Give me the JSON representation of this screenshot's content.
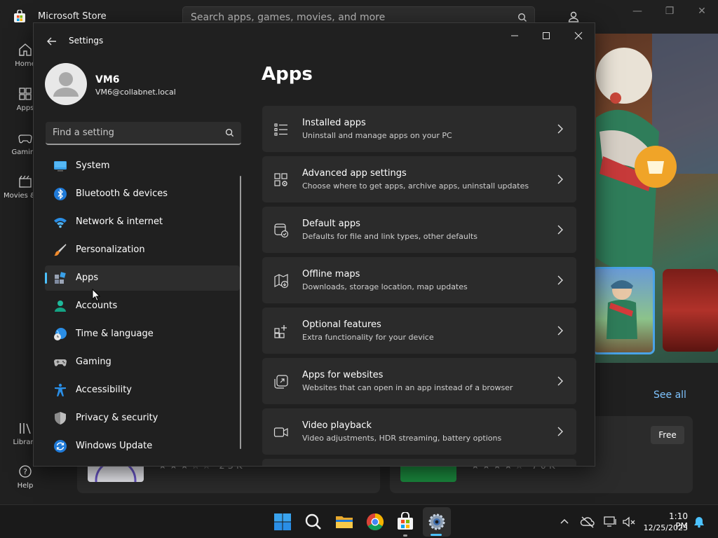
{
  "store": {
    "title": "Microsoft Store",
    "search_placeholder": "Search apps, games, movies, and more",
    "nav": [
      {
        "label": "Home",
        "icon": "home-icon"
      },
      {
        "label": "Apps",
        "icon": "apps-icon"
      },
      {
        "label": "Gaming",
        "icon": "gaming-icon"
      },
      {
        "label": "Movies & TV",
        "icon": "movies-icon"
      },
      {
        "label": "Library",
        "icon": "library-icon"
      },
      {
        "label": "Help",
        "icon": "help-icon"
      }
    ],
    "see_all": "See all",
    "free_badge": "Free",
    "card1_reviews": "23K",
    "card2_reviews": "70K"
  },
  "settings": {
    "window_title": "Settings",
    "user": {
      "name": "VM6",
      "email": "VM6@collabnet.local"
    },
    "search_placeholder": "Find a setting",
    "nav": [
      {
        "label": "System",
        "icon": "system-icon",
        "active": false
      },
      {
        "label": "Bluetooth & devices",
        "icon": "bluetooth-icon",
        "active": false
      },
      {
        "label": "Network & internet",
        "icon": "wifi-icon",
        "active": false
      },
      {
        "label": "Personalization",
        "icon": "brush-icon",
        "active": false
      },
      {
        "label": "Apps",
        "icon": "apps-icon",
        "active": true
      },
      {
        "label": "Accounts",
        "icon": "accounts-icon",
        "active": false
      },
      {
        "label": "Time & language",
        "icon": "globe-clock-icon",
        "active": false
      },
      {
        "label": "Gaming",
        "icon": "controller-icon",
        "active": false
      },
      {
        "label": "Accessibility",
        "icon": "accessibility-icon",
        "active": false
      },
      {
        "label": "Privacy & security",
        "icon": "shield-icon",
        "active": false
      },
      {
        "label": "Windows Update",
        "icon": "update-icon",
        "active": false
      }
    ],
    "page_title": "Apps",
    "cards": [
      {
        "title": "Installed apps",
        "subtitle": "Uninstall and manage apps on your PC",
        "icon": "list-icon"
      },
      {
        "title": "Advanced app settings",
        "subtitle": "Choose where to get apps, archive apps, uninstall updates",
        "icon": "app-settings-icon"
      },
      {
        "title": "Default apps",
        "subtitle": "Defaults for file and link types, other defaults",
        "icon": "default-apps-icon"
      },
      {
        "title": "Offline maps",
        "subtitle": "Downloads, storage location, map updates",
        "icon": "map-icon"
      },
      {
        "title": "Optional features",
        "subtitle": "Extra functionality for your device",
        "icon": "optional-features-icon"
      },
      {
        "title": "Apps for websites",
        "subtitle": "Websites that can open in an app instead of a browser",
        "icon": "open-external-icon"
      },
      {
        "title": "Video playback",
        "subtitle": "Video adjustments, HDR streaming, battery options",
        "icon": "video-icon"
      }
    ]
  },
  "taskbar": {
    "time": "1:10 PM",
    "date": "12/25/2023",
    "accent": "#4cc2ff"
  }
}
